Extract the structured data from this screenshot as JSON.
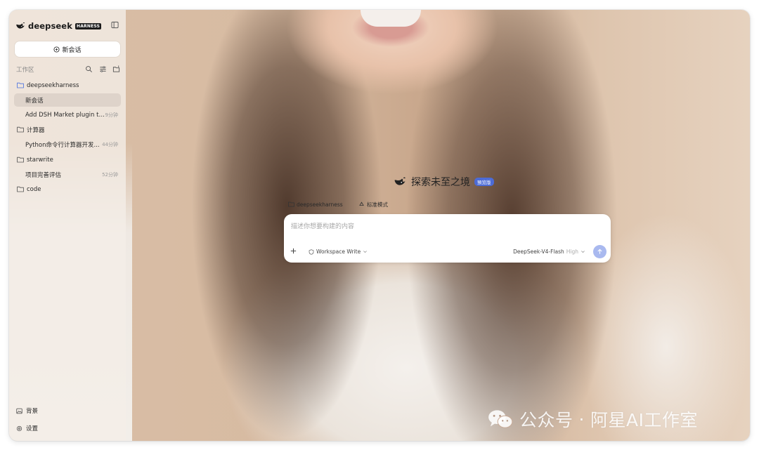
{
  "app": {
    "brand_name": "deepseek",
    "brand_badge": "HARNESS"
  },
  "sidebar": {
    "new_chat_label": "新会话",
    "workspace_label": "工作区",
    "projects": [
      {
        "name": "deepseekharness",
        "chats": [
          {
            "title": "新会话",
            "time": ""
          },
          {
            "title": "Add DSH Market plugin to ...",
            "time": "9分钟"
          }
        ]
      },
      {
        "name": "计算器",
        "chats": [
          {
            "title": "Python命令行计算器开发...",
            "time": "44分钟"
          }
        ]
      },
      {
        "name": "starwrite",
        "chats": [
          {
            "title": "项目完善评估",
            "time": "52分钟"
          }
        ]
      },
      {
        "name": "code",
        "chats": []
      }
    ],
    "bottom": {
      "background_label": "背景",
      "settings_label": "设置"
    }
  },
  "main": {
    "hero_title": "探索未至之境",
    "hero_badge": "預览版",
    "workspace_chip": "deepseekharness",
    "mode_chip": "标准模式",
    "composer": {
      "placeholder": "描述你想要构建的内容",
      "permission": "Workspace Write",
      "model": "DeepSeek-V4-Flash",
      "effort": "High"
    }
  },
  "watermark": {
    "left": "公众号",
    "dot": "·",
    "right": "阿星AI工作室"
  },
  "colors": {
    "accent": "#4c6bd6",
    "send_button": "#a9b9ef",
    "folder_active": "#4a72e0"
  }
}
